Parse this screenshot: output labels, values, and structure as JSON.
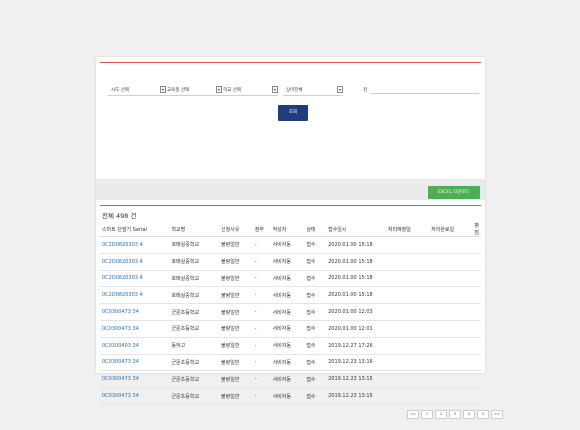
{
  "filters": {
    "region": "시도 선택",
    "office": "교육청 선택",
    "school": "학교 선택",
    "status": "상이전체",
    "search_label": "검",
    "search_button": "조회"
  },
  "toolbar": {
    "excel_button": "EXCEL 다운로드"
  },
  "summary": {
    "total_text": "전체 498 건"
  },
  "table": {
    "headers": [
      "스마트 단말기 Serial",
      "학교명",
      "신청사유",
      "첨부",
      "작성자",
      "상태",
      "접수일시",
      "처리예정일",
      "처리완료일",
      "평점"
    ],
    "rows": [
      [
        "0C2D0820303 4",
        "호매실중학교",
        "불량일반",
        "-",
        "서비자동",
        "접수",
        "2020.01.00 15:18",
        "",
        "",
        ""
      ],
      [
        "0C2D0820303 4",
        "호매실중학교",
        "불량일반",
        "-",
        "서비자동",
        "접수",
        "2020.01.00 15:18",
        "",
        "",
        ""
      ],
      [
        "0C2D0820303 4",
        "호매실중학교",
        "불량일반",
        "-",
        "서비자동",
        "접수",
        "2020.01.00 15:18",
        "",
        "",
        ""
      ],
      [
        "0C2D0820303 4",
        "호매실중학교",
        "불량일반",
        "-",
        "서비자동",
        "접수",
        "2020.01.00 15:18",
        "",
        "",
        ""
      ],
      [
        "0C0300473 34",
        "군문초등학교",
        "불량일반",
        "-",
        "서비자동",
        "접수",
        "2020.01.00 12:03",
        "",
        "",
        ""
      ],
      [
        "0C0300473 34",
        "군문초등학교",
        "불량일반",
        "-",
        "서비자동",
        "접수",
        "2020.01.00 12:01",
        "",
        "",
        ""
      ],
      [
        "0C0100403 34",
        "동하고",
        "불량일반",
        "-",
        "서비자동",
        "접수",
        "2019.12.27 17:26",
        "",
        "",
        ""
      ],
      [
        "0C0300473 34",
        "군문초등학교",
        "불량일반",
        "-",
        "서비자동",
        "접수",
        "2019.12.23 13:16",
        "",
        "",
        ""
      ],
      [
        "0C0300473 34",
        "군문초등학교",
        "불량일반",
        "-",
        "서비자동",
        "접수",
        "2019.12.23 13:15",
        "",
        "",
        ""
      ],
      [
        "0C0300473 34",
        "군문초등학교",
        "불량일반",
        "-",
        "서비자동",
        "접수",
        "2019.12.23 13:15",
        "",
        "",
        ""
      ]
    ]
  },
  "pagination": [
    "<<",
    "1",
    "2",
    "3",
    "4",
    "5",
    ">>"
  ]
}
